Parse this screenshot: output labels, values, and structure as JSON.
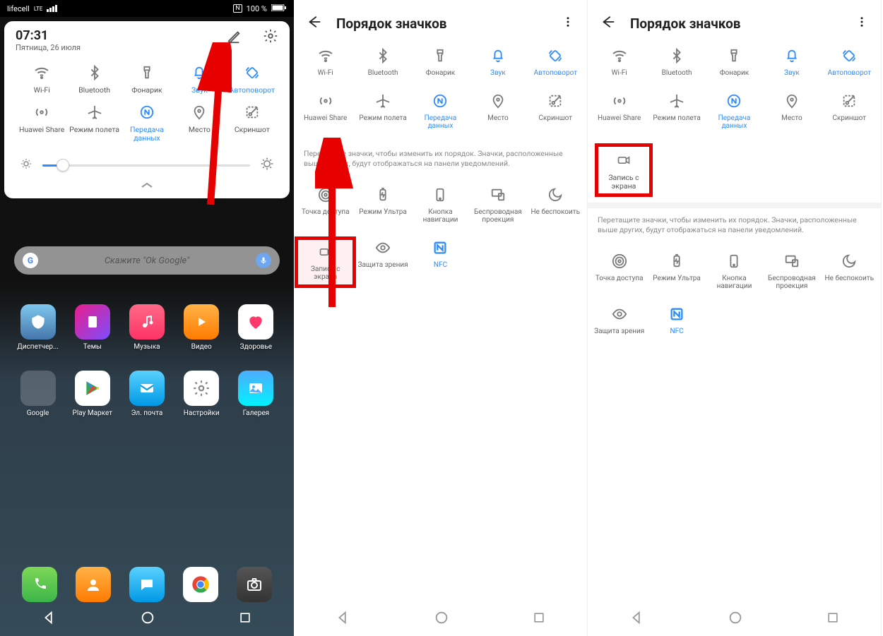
{
  "statusbar": {
    "carrier": "lifecell",
    "lte": "LTE",
    "nfc_indicator": "N",
    "battery_pct": "100 %"
  },
  "card": {
    "time": "07:31",
    "date": "Пятница, 26 июля"
  },
  "toggles_row1": {
    "wifi": "Wi-Fi",
    "bluetooth": "Bluetooth",
    "flashlight": "Фонарик",
    "sound": "Звук",
    "autorotate": "Автоповорот"
  },
  "toggles_row2": {
    "huaweishare": "Huawei Share",
    "airplane": "Режим полета",
    "data": "Передача данных",
    "location": "Место",
    "screenshot": "Скриншот"
  },
  "search_placeholder": "Скажите \"Ok Google\"",
  "apps_r1": {
    "a1": "Диспетчер...",
    "a2": "Темы",
    "a3": "Музыка",
    "a4": "Видео",
    "a5": "Здоровье"
  },
  "apps_r2": {
    "a1": "Google",
    "a2": "Play Маркет",
    "a3": "Эл. почта",
    "a4": "Настройки",
    "a5": "Галерея"
  },
  "panel_header": {
    "title": "Порядок значков"
  },
  "extra_toggles": {
    "hotspot": "Точка доступа",
    "ultra": "Режим Ультра",
    "navbtn": "Кнопка навигации",
    "cast": "Беспроводная проекция",
    "dnd": "Не беспокоить",
    "screenrec": "Запись с экрана",
    "eyecare": "Защита зрения",
    "nfc": "NFC"
  },
  "hint_text": "Перетащите значки, чтобы изменить их порядок. Значки, расположенные выше других, будут отображаться на панели уведомлений."
}
